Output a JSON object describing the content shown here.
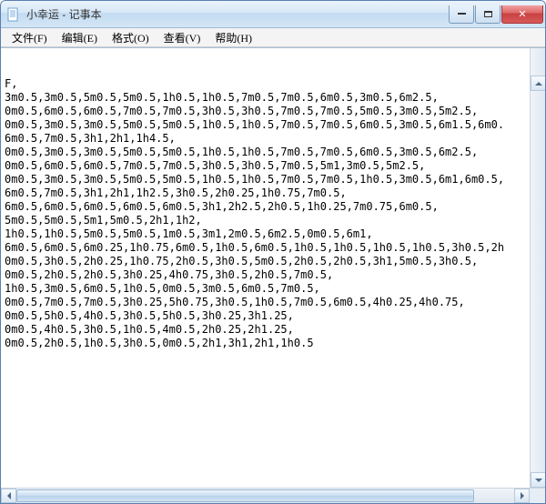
{
  "window": {
    "title": "小幸运 - 记事本"
  },
  "menu": {
    "file": "文件(F)",
    "edit": "编辑(E)",
    "format": "格式(O)",
    "view": "查看(V)",
    "help": "帮助(H)"
  },
  "content_lines": [
    "F,",
    "3m0.5,3m0.5,5m0.5,5m0.5,1h0.5,1h0.5,7m0.5,7m0.5,6m0.5,3m0.5,6m2.5,",
    "0m0.5,6m0.5,6m0.5,7m0.5,7m0.5,3h0.5,3h0.5,7m0.5,7m0.5,5m0.5,3m0.5,5m2.5,",
    "0m0.5,3m0.5,3m0.5,5m0.5,5m0.5,1h0.5,1h0.5,7m0.5,7m0.5,6m0.5,3m0.5,6m1.5,6m0.",
    "6m0.5,7m0.5,3h1,2h1,1h4.5,",
    "0m0.5,3m0.5,3m0.5,5m0.5,5m0.5,1h0.5,1h0.5,7m0.5,7m0.5,6m0.5,3m0.5,6m2.5,",
    "0m0.5,6m0.5,6m0.5,7m0.5,7m0.5,3h0.5,3h0.5,7m0.5,5m1,3m0.5,5m2.5,",
    "0m0.5,3m0.5,3m0.5,5m0.5,5m0.5,1h0.5,1h0.5,7m0.5,7m0.5,1h0.5,3m0.5,6m1,6m0.5,",
    "6m0.5,7m0.5,3h1,2h1,1h2.5,3h0.5,2h0.25,1h0.75,7m0.5,",
    "6m0.5,6m0.5,6m0.5,6m0.5,6m0.5,3h1,2h2.5,2h0.5,1h0.25,7m0.75,6m0.5,",
    "5m0.5,5m0.5,5m1,5m0.5,2h1,1h2,",
    "1h0.5,1h0.5,5m0.5,5m0.5,1m0.5,3m1,2m0.5,6m2.5,0m0.5,6m1,",
    "6m0.5,6m0.5,6m0.25,1h0.75,6m0.5,1h0.5,6m0.5,1h0.5,1h0.5,1h0.5,1h0.5,3h0.5,2h",
    "0m0.5,3h0.5,2h0.25,1h0.75,2h0.5,3h0.5,5m0.5,2h0.5,2h0.5,3h1,5m0.5,3h0.5,",
    "0m0.5,2h0.5,2h0.5,3h0.25,4h0.75,3h0.5,2h0.5,7m0.5,",
    "1h0.5,3m0.5,6m0.5,1h0.5,0m0.5,3m0.5,6m0.5,7m0.5,",
    "0m0.5,7m0.5,7m0.5,3h0.25,5h0.75,3h0.5,1h0.5,7m0.5,6m0.5,4h0.25,4h0.75,",
    "0m0.5,5h0.5,4h0.5,3h0.5,5h0.5,3h0.25,3h1.25,",
    "0m0.5,4h0.5,3h0.5,1h0.5,4m0.5,2h0.25,2h1.25,",
    "0m0.5,2h0.5,1h0.5,3h0.5,0m0.5,2h1,3h1,2h1,1h0.5"
  ]
}
